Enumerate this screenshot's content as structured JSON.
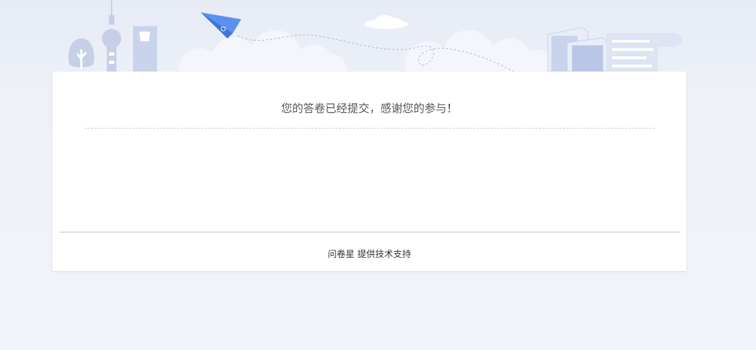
{
  "message": {
    "text": "您的答卷已经提交，感谢您的参与",
    "exclamation": "！"
  },
  "footer": {
    "brand": "问卷星",
    "support_text": "提供技术支持"
  },
  "colors": {
    "page_bg": "#eef1f8",
    "illustration": "#c9d3ea",
    "plane": "#5b8ff0"
  }
}
